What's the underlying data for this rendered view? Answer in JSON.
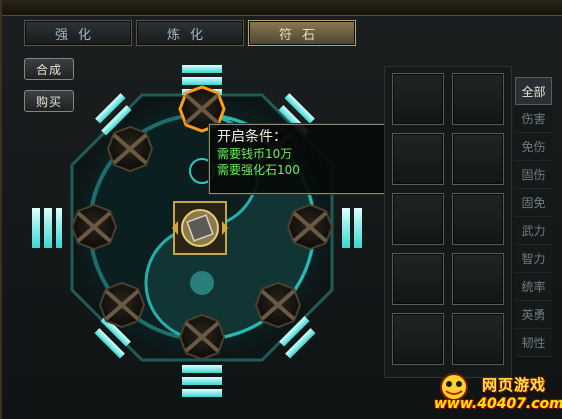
{
  "tabs": [
    {
      "label": "强化",
      "active": false
    },
    {
      "label": "炼化",
      "active": false
    },
    {
      "label": "符石",
      "active": true
    }
  ],
  "side_buttons": {
    "compose": "合成",
    "buy": "购买"
  },
  "tooltip": {
    "title": "开启条件：",
    "line1": "需要钱币10万",
    "line2": "需要强化石100"
  },
  "categories": [
    {
      "label": "全部",
      "active": true
    },
    {
      "label": "伤害",
      "active": false
    },
    {
      "label": "免伤",
      "active": false
    },
    {
      "label": "固伤",
      "active": false
    },
    {
      "label": "固免",
      "active": false
    },
    {
      "label": "武力",
      "active": false
    },
    {
      "label": "智力",
      "active": false
    },
    {
      "label": "统率",
      "active": false
    },
    {
      "label": "英勇",
      "active": false
    },
    {
      "label": "韧性",
      "active": false
    }
  ],
  "colors": {
    "accent_cyan": "#2ec8c0",
    "tooltip_green": "#6cf25a",
    "active_tab": "#8a7a55",
    "selected_slot_glow": "#ff9a1a"
  },
  "watermark": {
    "title": "网页游戏",
    "url": "www.40407.com"
  }
}
